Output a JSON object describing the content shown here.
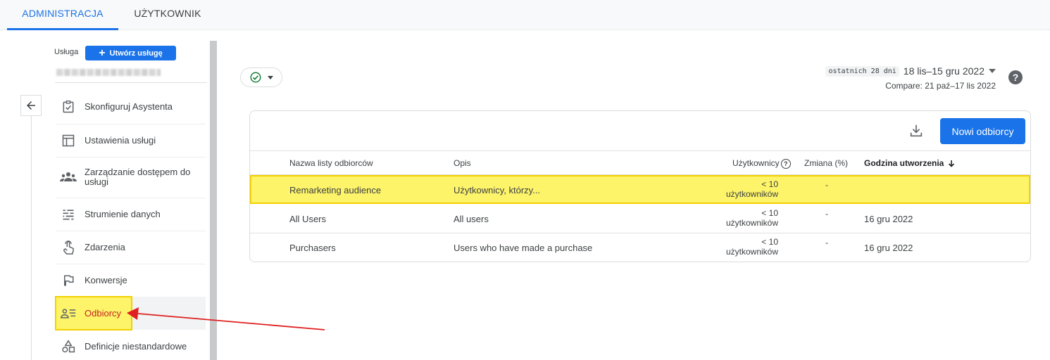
{
  "tabs": [
    {
      "label": "ADMINISTRACJA",
      "active": true
    },
    {
      "label": "UŻYTKOWNIK",
      "active": false
    }
  ],
  "sidebar": {
    "service_label": "Usługa",
    "create_button": "Utwórz usługę",
    "items": [
      {
        "label": "Skonfiguruj Asystenta",
        "icon": "checklist-icon"
      },
      {
        "label": "Ustawienia usługi",
        "icon": "layout-icon"
      },
      {
        "label": "Zarządzanie dostępem do usługi",
        "icon": "people-icon"
      },
      {
        "label": "Strumienie danych",
        "icon": "streams-icon"
      },
      {
        "label": "Zdarzenia",
        "icon": "touch-icon"
      },
      {
        "label": "Konwersje",
        "icon": "flag-icon"
      },
      {
        "label": "Odbiorcy",
        "icon": "audience-icon",
        "selected": true
      },
      {
        "label": "Definicje niestandardowe",
        "icon": "shapes-icon"
      }
    ]
  },
  "date": {
    "chip": "ostatnich 28 dni",
    "range": "18 lis–15 gru 2022",
    "compare": "Compare: 21 paź–17 lis 2022"
  },
  "toolbar": {
    "new_button": "Nowi odbiorcy"
  },
  "table": {
    "headers": {
      "name": "Nazwa listy odbiorców",
      "desc": "Opis",
      "users": "Użytkownicy",
      "change": "Zmiana (%)",
      "created": "Godzina utworzenia"
    },
    "rows": [
      {
        "name": "Remarketing audience",
        "desc": "Użytkownicy, którzy...",
        "users_1": "< 10",
        "users_2": "użytkowników",
        "change": "-",
        "created": ""
      },
      {
        "name": "All Users",
        "desc": "All users",
        "users_1": "< 10",
        "users_2": "użytkowników",
        "change": "-",
        "created": "16 gru 2022"
      },
      {
        "name": "Purchasers",
        "desc": "Users who have made a purchase",
        "users_1": "< 10",
        "users_2": "użytkowników",
        "change": "-",
        "created": "16 gru 2022"
      }
    ]
  },
  "colors": {
    "accent": "#1a73e8",
    "highlight": "#fdf46a",
    "annotation": "#e02020"
  }
}
